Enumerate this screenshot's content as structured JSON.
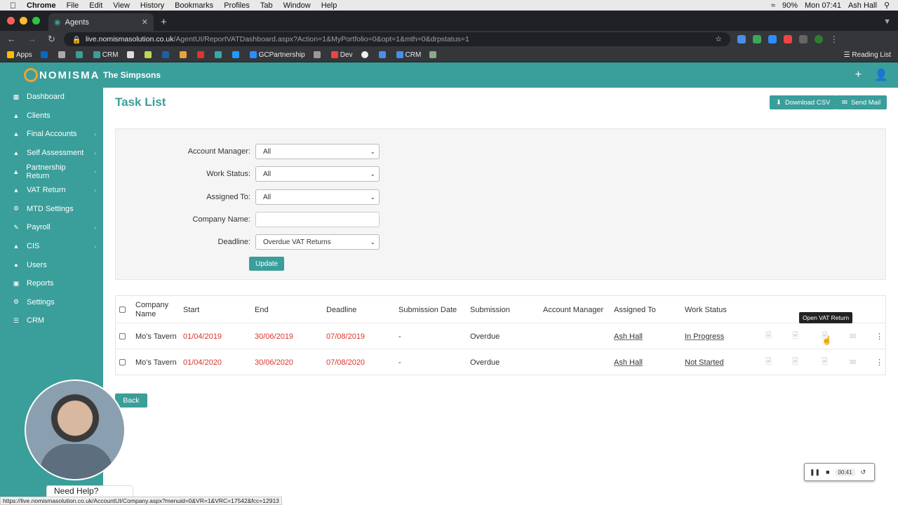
{
  "macos": {
    "app": "Chrome",
    "menus": [
      "File",
      "Edit",
      "View",
      "History",
      "Bookmarks",
      "Profiles",
      "Tab",
      "Window",
      "Help"
    ],
    "battery": "90%",
    "clock": "Mon 07:41",
    "user": "Ash Hall"
  },
  "browser": {
    "tab_title": "Agents",
    "url_host": "live.nomismasolution.co.uk",
    "url_path": "/AgentUI/ReportVATDashboard.aspx?Action=1&MyPortfolio=0&opt=1&mth=0&drpstatus=1",
    "bookmarks": [
      "Apps",
      "CRM",
      "GCPartnership",
      "Dev",
      "CRM"
    ],
    "reading_list": "Reading List"
  },
  "app": {
    "logo": "NOMISMA",
    "org_name": "The Simpsons"
  },
  "sidebar": {
    "items": [
      {
        "label": "Dashboard",
        "icon": "dashboard-icon",
        "chevron": false
      },
      {
        "label": "Clients",
        "icon": "clients-icon",
        "chevron": false
      },
      {
        "label": "Final Accounts",
        "icon": "final-accounts-icon",
        "chevron": true
      },
      {
        "label": "Self Assessment",
        "icon": "self-assessment-icon",
        "chevron": true
      },
      {
        "label": "Partnership Return",
        "icon": "partnership-icon",
        "chevron": true
      },
      {
        "label": "VAT Return",
        "icon": "vat-icon",
        "chevron": true
      },
      {
        "label": "MTD Settings",
        "icon": "mtd-icon",
        "chevron": false
      },
      {
        "label": "Payroll",
        "icon": "payroll-icon",
        "chevron": true
      },
      {
        "label": "CIS",
        "icon": "cis-icon",
        "chevron": true
      },
      {
        "label": "Users",
        "icon": "users-icon",
        "chevron": false
      },
      {
        "label": "Reports",
        "icon": "reports-icon",
        "chevron": false
      },
      {
        "label": "Settings",
        "icon": "settings-icon",
        "chevron": false
      },
      {
        "label": "CRM",
        "icon": "crm-icon",
        "chevron": false
      }
    ]
  },
  "page": {
    "title": "Task List",
    "download_csv": "Download CSV",
    "send_mail": "Send Mail",
    "back": "Back",
    "tooltip": "Open VAT Return"
  },
  "filters": {
    "account_manager": {
      "label": "Account Manager:",
      "value": "All"
    },
    "work_status": {
      "label": "Work Status:",
      "value": "All"
    },
    "assigned_to": {
      "label": "Assigned To:",
      "value": "All"
    },
    "company_name": {
      "label": "Company Name:",
      "value": ""
    },
    "deadline": {
      "label": "Deadline:",
      "value": "Overdue VAT Returns"
    },
    "update": "Update"
  },
  "table": {
    "headers": {
      "company_name": "Company Name",
      "start": "Start",
      "end": "End",
      "deadline": "Deadline",
      "submission_date": "Submission Date",
      "submission": "Submission",
      "account_manager": "Account Manager",
      "assigned_to": "Assigned To",
      "work_status": "Work Status"
    },
    "rows": [
      {
        "company": "Mo's Tavern",
        "start": "01/04/2019",
        "end": "30/06/2019",
        "deadline": "07/08/2019",
        "submission_date": "-",
        "submission": "Overdue",
        "account_manager": "",
        "assigned_to": "Ash Hall",
        "work_status": "In Progress"
      },
      {
        "company": "Mo's Tavern",
        "start": "01/04/2020",
        "end": "30/06/2020",
        "deadline": "07/08/2020",
        "submission_date": "-",
        "submission": "Overdue",
        "account_manager": "",
        "assigned_to": "Ash Hall",
        "work_status": "Not Started"
      }
    ]
  },
  "overlay": {
    "help_text": "Need Help?",
    "status_url": "https://live.nomismasolution.co.uk/AccountUI/Company.aspx?menuid=0&VR=1&VRC=17542&fcc=12913",
    "recorder_time": "00:41"
  }
}
